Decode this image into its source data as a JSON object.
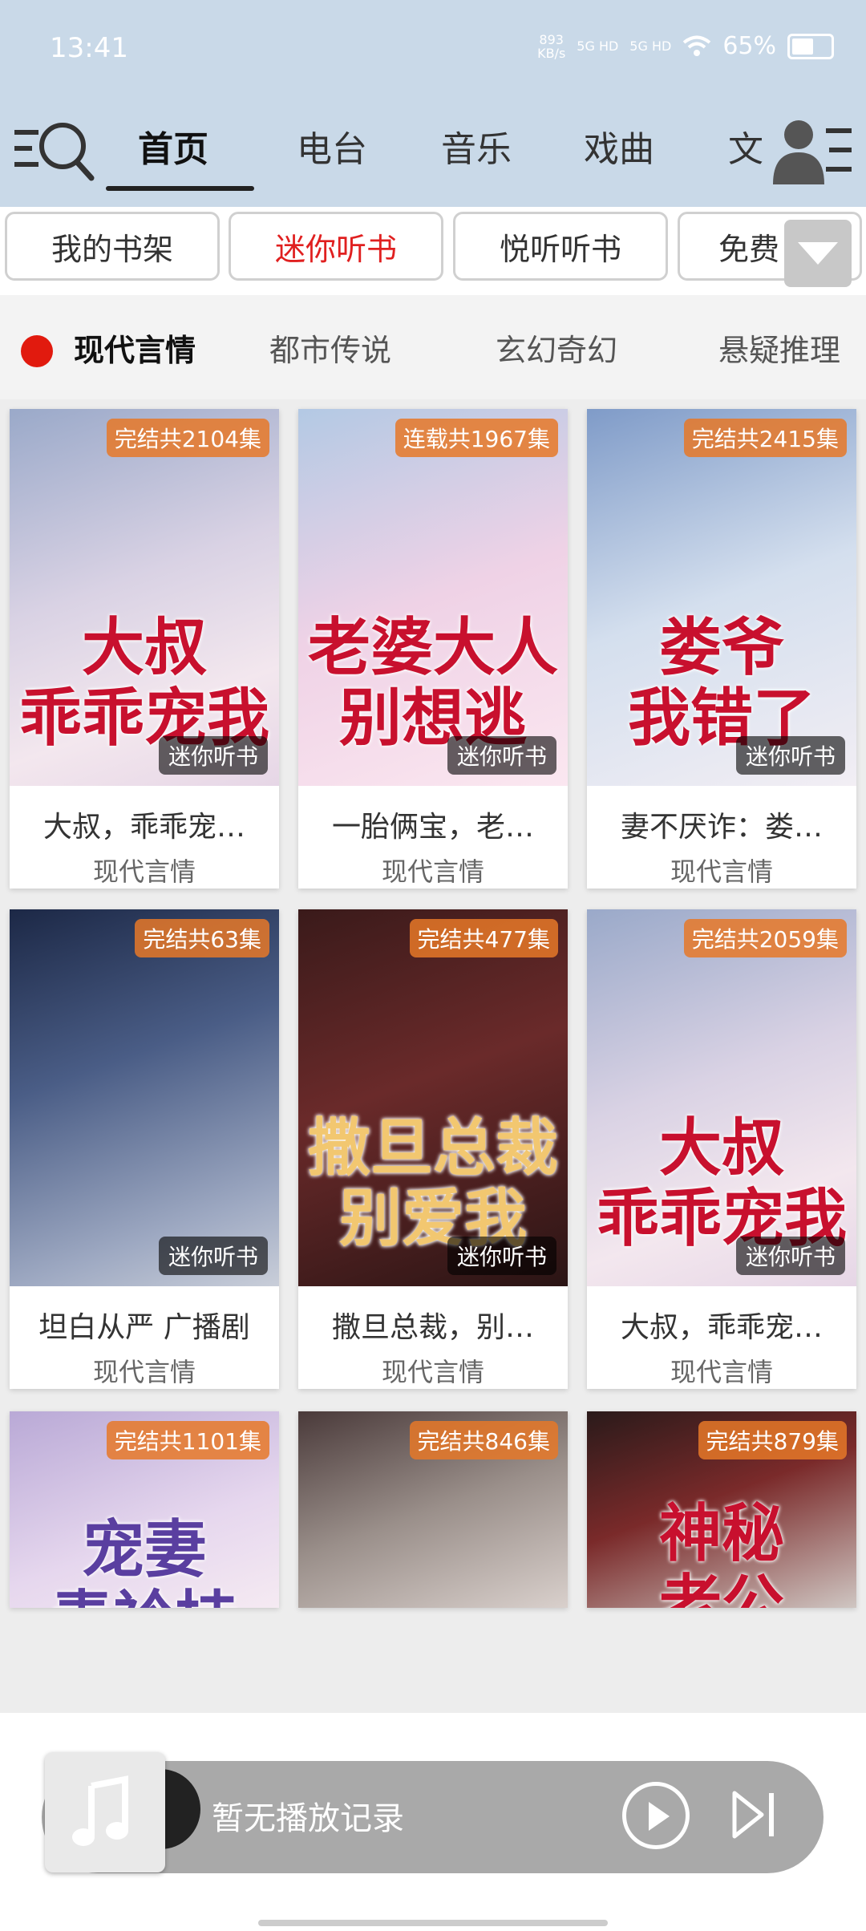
{
  "status": {
    "time": "13:41",
    "net_speed": "893\nKB/s",
    "sig1": "5G HD",
    "sig2": "5G HD",
    "battery": "65%",
    "battery_level": 0.65
  },
  "nav": {
    "tabs": [
      "首页",
      "电台",
      "音乐",
      "戏曲",
      "文"
    ],
    "active": 0
  },
  "chips": [
    "我的书架",
    "迷你听书",
    "悦听听书",
    "免费"
  ],
  "categories": [
    "现代言情",
    "都市传说",
    "玄幻奇幻",
    "悬疑推理"
  ],
  "cards": [
    {
      "badge": "完结共2104集",
      "cover_text": "大叔\n乖乖宠我",
      "source": "迷你听书",
      "title": "大叔，乖乖宠…",
      "genre": "现代言情",
      "bg": "linear-gradient(160deg,#9aa9c9 0%,#d9d2e4 45%,#f3e7ee 75%,#e6d6e6 100%)"
    },
    {
      "badge": "连载共1967集",
      "cover_text": "老婆大人\n别想逃",
      "source": "迷你听书",
      "title": "一胎俩宝，老…",
      "genre": "现代言情",
      "bg": "linear-gradient(160deg,#b3c9e4 0%,#efd2e6 50%,#fbe7f0 100%)"
    },
    {
      "badge": "完结共2415集",
      "cover_text": "娄爷\n我错了",
      "source": "迷你听书",
      "title": "妻不厌诈：娄…",
      "genre": "现代言情",
      "bg": "linear-gradient(160deg,#7f9bc8 0%,#d4dfee 50%,#f2eef4 100%)"
    },
    {
      "badge": "完结共63集",
      "cover_text": "",
      "source": "迷你听书",
      "title": "坦白从严 广播剧",
      "genre": "现代言情",
      "bg": "linear-gradient(160deg,#1c2846 0%,#4a5d86 40%,#9ea9c2 80%,#c9ced9 100%)"
    },
    {
      "badge": "完结共477集",
      "cover_text": "撒旦总裁\n别爱我",
      "source": "迷你听书",
      "title": "撒旦总裁，别…",
      "genre": "现代言情",
      "bg": "linear-gradient(160deg,#3a1a1a 0%,#6a2a2a 45%,#2a1414 100%)"
    },
    {
      "badge": "完结共2059集",
      "cover_text": "大叔\n乖乖宠我",
      "source": "迷你听书",
      "title": "大叔，乖乖宠…",
      "genre": "现代言情",
      "bg": "linear-gradient(160deg,#9aa9c9 0%,#d9d2e4 45%,#f3e7ee 75%,#e6d6e6 100%)"
    },
    {
      "badge": "完结共1101集",
      "cover_text": "宠妻\n青衿持",
      "bg": "linear-gradient(160deg,#b9a9d6 0%,#e6d7ee 60%,#f5eaf2 100%)"
    },
    {
      "badge": "完结共846集",
      "cover_text": "",
      "bg": "linear-gradient(160deg,#4a3a3a 0%,#9a8f8a 50%,#d9d0cc 100%)"
    },
    {
      "badge": "完结共879集",
      "cover_text": "神秘\n老公",
      "bg": "linear-gradient(160deg,#2a1a1a 0%,#7a2a2a 45%,#cfc6c2 100%)"
    }
  ],
  "player": {
    "text": "暂无播放记录"
  },
  "colors": {
    "accent": "#e02020",
    "header_bg": "#c9d9e8"
  }
}
